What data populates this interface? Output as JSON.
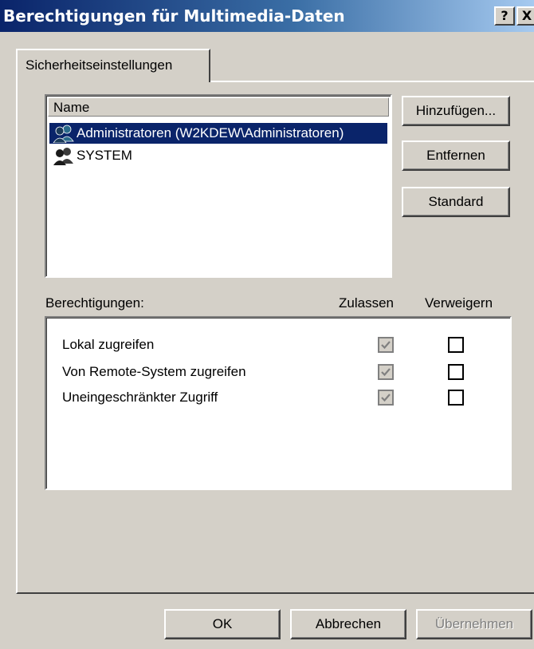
{
  "window": {
    "title": "Berechtigungen für Multimedia-Daten",
    "help_button": "?",
    "close_button": "X"
  },
  "tabs": [
    {
      "label": "Sicherheitseinstellungen",
      "active": true
    }
  ],
  "names_list": {
    "header": "Name",
    "items": [
      {
        "label": "Administratoren (W2KDEW\\Administratoren)",
        "icon": "group-icon",
        "selected": true
      },
      {
        "label": "SYSTEM",
        "icon": "group-icon",
        "selected": false
      }
    ]
  },
  "side_buttons": {
    "add": "Hinzufügen...",
    "remove": "Entfernen",
    "default": "Standard"
  },
  "permissions": {
    "label": "Berechtigungen:",
    "allow_header": "Zulassen",
    "deny_header": "Verweigern",
    "rows": [
      {
        "label": "Lokal zugreifen",
        "allow": true,
        "deny": false
      },
      {
        "label": "Von Remote-System zugreifen",
        "allow": true,
        "deny": false
      },
      {
        "label": "Uneingeschränkter Zugriff",
        "allow": true,
        "deny": false
      }
    ]
  },
  "footer_buttons": {
    "ok": "OK",
    "cancel": "Abbrechen",
    "apply": "Übernehmen",
    "apply_enabled": false
  },
  "colors": {
    "face": "#d4d0c8",
    "selection": "#0a246a",
    "title_start": "#0a246a",
    "title_end": "#a6caf0"
  }
}
